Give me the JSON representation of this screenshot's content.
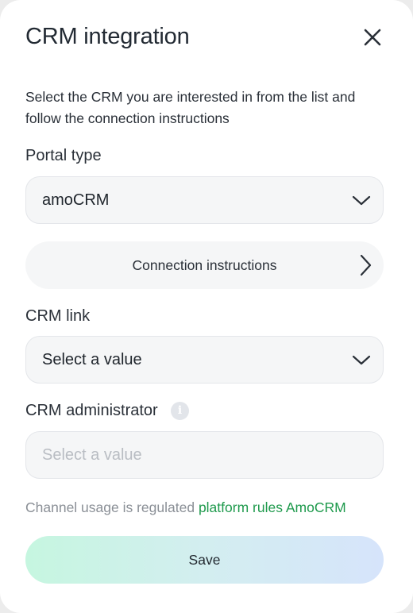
{
  "dialog": {
    "title": "CRM integration",
    "description": "Select the CRM you are interested in from the list and follow the connection instructions"
  },
  "portal_type": {
    "label": "Portal type",
    "value": "amoCRM"
  },
  "instructions": {
    "label": "Connection instructions"
  },
  "crm_link": {
    "label": "CRM link",
    "value": "Select a value"
  },
  "crm_admin": {
    "label": "CRM administrator",
    "info_icon": "info-icon",
    "placeholder": "Select a value"
  },
  "footnote": {
    "text": "Channel usage is regulated ",
    "link": "platform rules AmoCRM"
  },
  "actions": {
    "save": "Save"
  },
  "colors": {
    "link": "#1f9a4d",
    "save_gradient_start": "#c6f6e0",
    "save_gradient_end": "#d6e4fb"
  }
}
